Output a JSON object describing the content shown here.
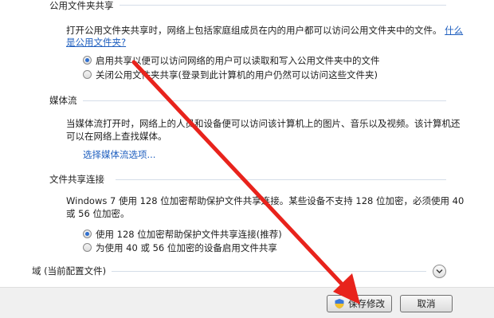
{
  "public_folder": {
    "title": "公用文件夹共享",
    "desc_line1": "打开公用文件夹共享时，网络上包括家庭组成员在内的用户都可以访问公用文件夹中的文件。",
    "desc_link_a": "什么",
    "desc_link_b": "是公用文件夹?",
    "option_on": "启用共享以便可以访问网络的用户可以读取和写入公用文件夹中的文件",
    "option_off": "关闭公用文件夹共享(登录到此计算机的用户仍然可以访问这些文件夹)"
  },
  "media_streaming": {
    "title": "媒体流",
    "desc_line1": "当媒体流打开时，网络上的人员和设备便可以访问该计算机上的图片、音乐以及视频。该计算机还",
    "desc_line2": "可以在网络上查找媒体。",
    "link": "选择媒体流选项..."
  },
  "file_sharing_connections": {
    "title": "文件共享连接",
    "desc_line1": "Windows 7 使用 128 位加密帮助保护文件共享连接。某些设备不支持 128 位加密，必须使用 40",
    "desc_line2": "或 56 位加密。",
    "option_128": "使用 128 位加密帮助保护文件共享连接(推荐)",
    "option_40_56": "为使用 40 或 56 位加密的设备启用文件共享"
  },
  "domain_profile": {
    "title": "域 (当前配置文件)"
  },
  "footer": {
    "save_label": "保存修改",
    "cancel_label": "取消"
  },
  "colors": {
    "link": "#1f5fbf",
    "arrow": "#e8231c"
  },
  "icons": [
    "radio-selected-icon",
    "radio-unselected-icon",
    "chevron-down-icon",
    "uac-shield-icon",
    "red-arrow-annotation"
  ]
}
